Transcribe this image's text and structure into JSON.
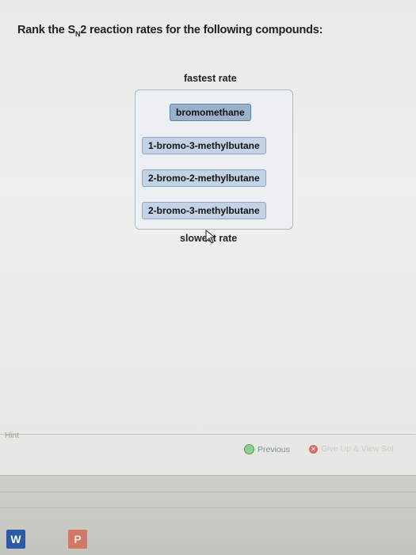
{
  "question": {
    "prefix": "Rank the S",
    "subscript": "N",
    "suffix": "2 reaction rates for the following compounds:"
  },
  "ranking": {
    "top_label": "fastest rate",
    "bottom_label": "slowest rate",
    "items": [
      {
        "label": "bromomethane"
      },
      {
        "label": "1-bromo-3-methylbutane"
      },
      {
        "label": "2-bromo-2-methylbutane"
      },
      {
        "label": "2-bromo-3-methylbutane"
      }
    ]
  },
  "footer": {
    "hint": "Hint",
    "previous": "Previous",
    "give_up": "Give Up & View Sol"
  },
  "taskbar": {
    "word": "W",
    "powerpoint": "P"
  },
  "colors": {
    "item_bg": "#c3d3e6",
    "item_active_bg": "#9ab1ca",
    "box_border": "#a9b9cf"
  }
}
